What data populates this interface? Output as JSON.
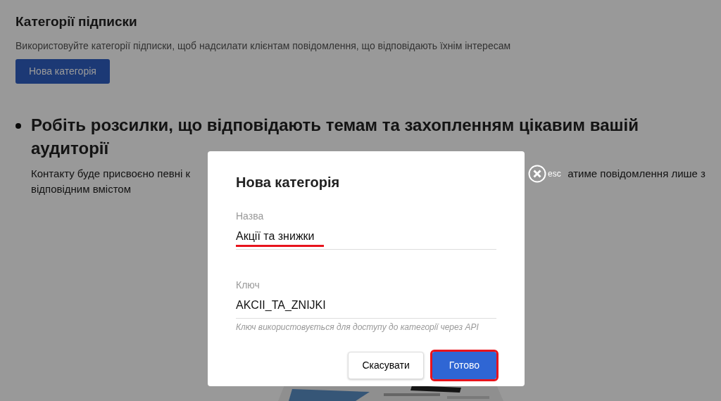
{
  "page": {
    "title": "Категорії підписки",
    "subtitle": "Використовуйте категорії підписки, щоб надсилати клієнтам повідомлення, що відповідають їхнім інтересам",
    "new_button": "Нова категорія",
    "bullet_heading": "Робіть розсилки, що відповідають темам та захопленням цікавим вашій аудиторії",
    "paragraph_left": "Контакту буде присвоєно певні к",
    "paragraph_right": "атиме повідомлення лише з",
    "paragraph_line2": "відповідним вмістом"
  },
  "close": {
    "label": "esc"
  },
  "modal": {
    "title": "Нова категорія",
    "fields": [
      {
        "label": "Назва",
        "value": "Акції та знижки",
        "highlighted": true
      },
      {
        "label": "Ключ",
        "value": "AKCII_TA_ZNIJKI",
        "hint": "Ключ використовується для доступу до категорії через API",
        "highlighted": false
      }
    ],
    "buttons": [
      {
        "label": "Скасувати",
        "kind": "secondary",
        "highlighted": false
      },
      {
        "label": "Готово",
        "kind": "primary",
        "highlighted": true
      }
    ]
  }
}
